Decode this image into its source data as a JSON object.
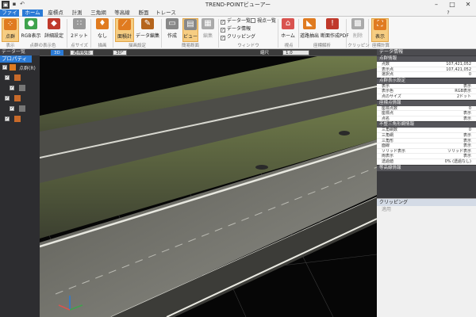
{
  "window": {
    "title": "TREND-POINTビューアー"
  },
  "tabs": [
    "ファイル",
    "ホーム",
    "座標点",
    "計測",
    "三角網",
    "等高線",
    "断面",
    "トレース"
  ],
  "ribbon": {
    "buttons": {
      "kanmu": "点群",
      "rgb": "RGB表示",
      "color_setting": "詳細設定",
      "dot_size": "2ドット",
      "none": "なし",
      "surface": "面積計",
      "data_edit": "データ編集",
      "create": "作成",
      "view": "ビュー",
      "edit": "編集",
      "home": "ホーム",
      "project_tools": "道路抽出",
      "coord_pdf": "断面作成PDF",
      "clip_delete": "削除",
      "clip_display": "表示"
    },
    "checks": {
      "data_list": "データ一覧",
      "point_list": "視点一覧",
      "data_info": "データ情報",
      "clipping": "クリッピング"
    },
    "groups": [
      "表示",
      "点群の表示色",
      "点サイズ",
      "描画",
      "描画設定",
      "簡易断面",
      "ウィンドウ",
      "視点",
      "座標解析",
      "クリッピング",
      "座標計算"
    ]
  },
  "left_panel": {
    "header": "データ一覧",
    "tab": "プロパティ",
    "rows": [
      {
        "label": "点群(R)"
      },
      {
        "label": ""
      },
      {
        "label": ""
      },
      {
        "label": ""
      },
      {
        "label": ""
      },
      {
        "label": ""
      }
    ]
  },
  "viewport": {
    "mode_3d": "3D",
    "view_type": "透視投影",
    "angle": "30°",
    "scale_label": "縮尺",
    "scale_value": "1.0"
  },
  "right_panel": {
    "header": "データ情報",
    "sections": [
      {
        "title": "点群情報",
        "rows": [
          {
            "k": "点数",
            "v": "107,421,052"
          },
          {
            "k": "表示点",
            "v": "107,421,052"
          },
          {
            "k": "選択点",
            "v": "0"
          }
        ]
      },
      {
        "title": "点群表示設定",
        "rows": [
          {
            "k": "表示",
            "v": "表示"
          },
          {
            "k": "表示色",
            "v": "RGB表示"
          },
          {
            "k": "点のサイズ",
            "v": "2ドット"
          }
        ]
      },
      {
        "title": "座標点情報",
        "rows": [
          {
            "k": "座標点数",
            "v": "0"
          },
          {
            "k": "座標点",
            "v": "表示"
          },
          {
            "k": "点名",
            "v": "表示"
          }
        ]
      },
      {
        "title": "不整三角形網情報",
        "rows": [
          {
            "k": "三角網数",
            "v": "0"
          },
          {
            "k": "三角網",
            "v": "表示"
          },
          {
            "k": "三角形",
            "v": "表示"
          },
          {
            "k": "面線",
            "v": "表示"
          },
          {
            "k": "ソリッド表示",
            "v": "ソリッド表示"
          },
          {
            "k": "両表示",
            "v": "表示"
          },
          {
            "k": "透過値",
            "v": "0% (透過なし)"
          }
        ]
      },
      {
        "title": "等高線情報",
        "rows": []
      }
    ]
  },
  "clipping": {
    "header": "クリッピング",
    "apply": "適用"
  },
  "colors": {
    "accent": "#2b7bd6",
    "highlight": "#f6cd82"
  }
}
